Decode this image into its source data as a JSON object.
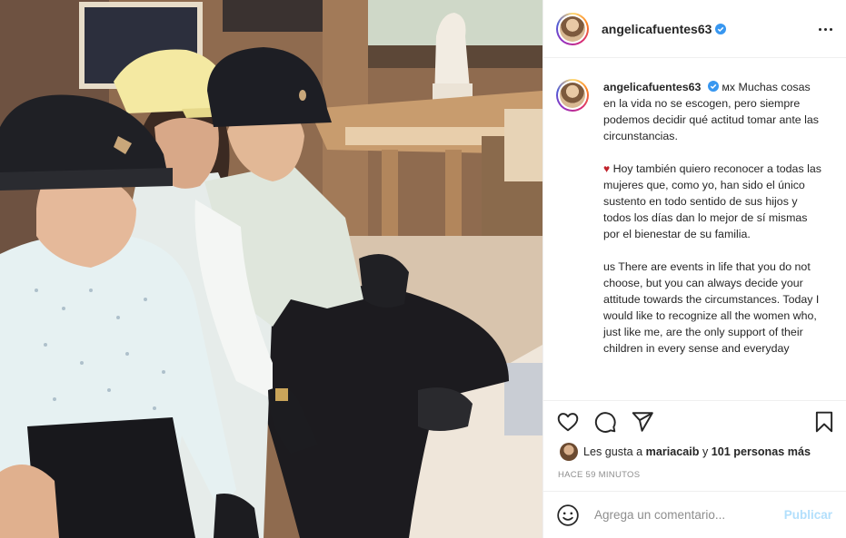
{
  "post": {
    "username": "angelicafuentes63",
    "more_icon": "more-horizontal-icon",
    "caption": {
      "username": "angelicafuentes63",
      "p1": "мх Muchas cosas en la vida no se escogen, pero siempre podemos decidir qué actitud tomar ante las circunstancias.",
      "p2_heart": "♥",
      "p2": " Hoy también quiero reconocer a todas las mujeres que, como yo, han sido el único sustento en todo sentido de sus hijos y todos los días dan lo mejor de sí mismas por el bienestar de su familia.",
      "p3": "us There are events in life that you do not choose, but you can always decide your attitude towards the circumstances. Today I would like to recognize all the women who, just like me, are the only support of their children in every sense and everyday"
    },
    "likes": {
      "prefix": "Les gusta a ",
      "user": "mariacaib",
      "middle": " y ",
      "others": "101 personas más"
    },
    "time": "HACE 59 MINUTOS",
    "comment": {
      "placeholder": "Agrega un comentario...",
      "value": "",
      "post_label": "Publicar"
    },
    "colors": {
      "verified": "#3897f0",
      "heart": "#c0222b",
      "post_disabled": "#b2dffc",
      "secondary_text": "#8e8e8e"
    }
  }
}
